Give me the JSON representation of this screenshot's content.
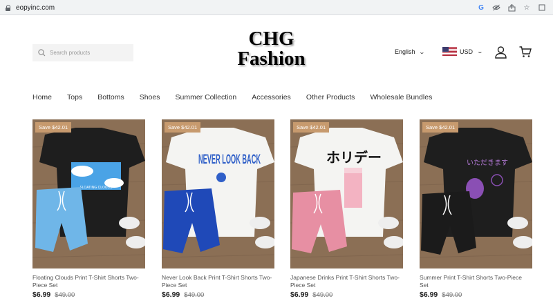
{
  "browser": {
    "url": "eopyinc.com"
  },
  "header": {
    "search_placeholder": "Search products",
    "logo_line1": "CHG",
    "logo_line2": "Fashion",
    "language": "English",
    "currency": "USD"
  },
  "nav": [
    "Home",
    "Tops",
    "Bottoms",
    "Shoes",
    "Summer Collection",
    "Accessories",
    "Other Products",
    "Wholesale Bundles"
  ],
  "products": [
    {
      "badge": "Save $42.01",
      "title": "Floating Clouds Print T-Shirt Shorts Two-Piece Set",
      "price": "$6.99",
      "compare": "$49.00",
      "shirt_print": "FLOATING CLOUDS"
    },
    {
      "badge": "Save $42.01",
      "title": "Never Look Back Print T-Shirt Shorts Two-Piece Set",
      "price": "$6.99",
      "compare": "$49.00",
      "shirt_print": "NEVER LOOK BACK"
    },
    {
      "badge": "Save $42.01",
      "title": "Japanese Drinks Print T-Shirt Shorts Two-Piece Set",
      "price": "$6.99",
      "compare": "$49.00",
      "shirt_print": "ホリデー"
    },
    {
      "badge": "Save $42.01",
      "title": "Summer Print T-Shirt Shorts Two-Piece Set",
      "price": "$6.99",
      "compare": "$49.00",
      "shirt_print": "いただきます"
    }
  ],
  "colors": {
    "badge": "#c79a6e",
    "wood": "#8b6f55",
    "shirt_black": "#1e1e1e",
    "shirt_white": "#f4f4f2",
    "shorts_lightblue": "#6fb6e8",
    "shorts_royal": "#1f49b8",
    "shorts_pink": "#e78fa3",
    "shorts_black": "#1b1b1b",
    "print_blue": "#2f5fc8",
    "print_purple": "#8a4fb4"
  }
}
